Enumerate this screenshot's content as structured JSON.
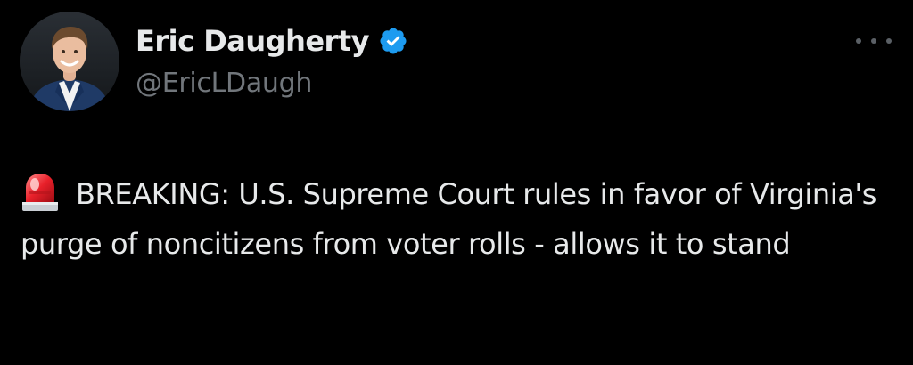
{
  "tweet": {
    "author": {
      "display_name": "Eric Daugherty",
      "handle": "@EricLDaugh",
      "verified": true,
      "avatar_icon": "profile-photo",
      "verified_icon": "verified-badge-icon"
    },
    "more_icon": "more-options-icon",
    "emoji_icon": "police-siren-emoji",
    "text": "BREAKING: U.S. Supreme Court rules in favor of Virginia's purge of noncitizens from voter rolls - allows it to stand"
  },
  "colors": {
    "background": "#000000",
    "primary_text": "#e7e9ea",
    "secondary_text": "#71767b",
    "verified_blue": "#1d9bf0"
  }
}
